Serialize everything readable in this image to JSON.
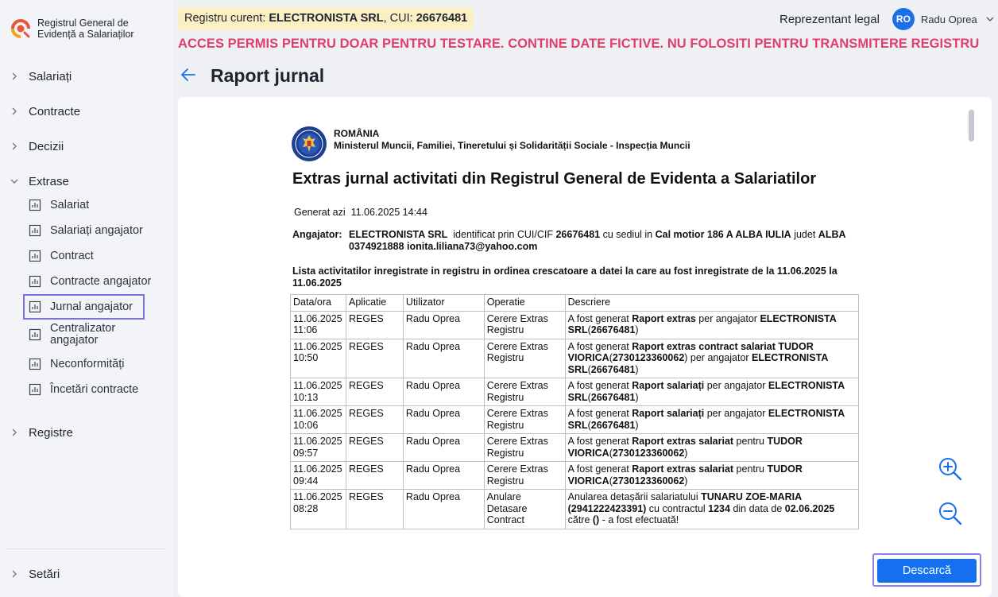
{
  "app": {
    "logo_text": "Registrul General de Evidență a Salariaților"
  },
  "header": {
    "registry_prefix": "Registru curent: ",
    "registry_company": "ELECTRONISTA SRL",
    "registry_cui_label": ", CUI: ",
    "registry_cui": "26676481",
    "role": "Reprezentant legal",
    "avatar_initials": "RO",
    "user_name": "Radu Oprea",
    "warning": "ACCES PERMIS PENTRU DOAR PENTRU TESTARE. CONTINE DATE FICTIVE. NU FOLOSITI PENTRU TRANSMITERE REGISTRU"
  },
  "page": {
    "title": "Raport jurnal"
  },
  "sidebar": {
    "sections": [
      {
        "label": "Salariați"
      },
      {
        "label": "Contracte"
      },
      {
        "label": "Decizii"
      },
      {
        "label": "Extrase"
      }
    ],
    "extrase_items": [
      {
        "label": "Salariat"
      },
      {
        "label": "Salariați angajator"
      },
      {
        "label": "Contract"
      },
      {
        "label": "Contracte angajator"
      },
      {
        "label": "Jurnal angajator",
        "active": true
      },
      {
        "label": "Centralizator angajator"
      },
      {
        "label": "Neconformități"
      },
      {
        "label": "Încetări contracte"
      }
    ],
    "registre": "Registre",
    "settings": "Setări"
  },
  "document": {
    "country": "ROMÂNIA",
    "ministry": "Ministerul Muncii, Familiei, Tineretului și Solidarității Sociale - Inspecția Muncii",
    "title": "Extras jurnal activitati din Registrul General de Evidenta a Salariatilor",
    "generated_label": "Generat azi",
    "generated_value": "11.06.2025 14:44",
    "employer_label": "Angajator:",
    "employer_name": "ELECTRONISTA SRL",
    "employer_id_text": "identificat prin CUI/CIF",
    "employer_cui": "26676481",
    "employer_seat_text": "cu sediul in",
    "employer_address": "Cal motior 186 A ALBA IULIA",
    "employer_county_text": "judet",
    "employer_county": "ALBA",
    "employer_phone": "0374921888",
    "employer_email": "ionita.liliana73@yahoo.com",
    "list_title": "Lista activitatilor inregistrate in registru in ordinea crescatoare a datei la care au fost inregistrate de la 11.06.2025 la 11.06.2025",
    "columns": [
      "Data/ora",
      "Aplicatie",
      "Utilizator",
      "Operatie",
      "Descriere"
    ],
    "rows": [
      {
        "date": "11.06.2025",
        "time": "11:06",
        "app": "REGES",
        "user": "Radu Oprea",
        "op": "Cerere Extras Registru",
        "desc": [
          {
            "t": "A fost generat "
          },
          {
            "b": "Raport extras"
          },
          {
            "t": " per angajator "
          },
          {
            "b": "ELECTRONISTA SRL"
          },
          {
            "t": "("
          },
          {
            "b": "26676481"
          },
          {
            "t": ")"
          }
        ]
      },
      {
        "date": "11.06.2025",
        "time": "10:50",
        "app": "REGES",
        "user": "Radu Oprea",
        "op": "Cerere Extras Registru",
        "desc": [
          {
            "t": "A fost generat "
          },
          {
            "b": "Raport extras contract salariat TUDOR VIORICA"
          },
          {
            "t": "("
          },
          {
            "b": "2730123360062"
          },
          {
            "t": ") per angajator "
          },
          {
            "b": "ELECTRONISTA SRL"
          },
          {
            "t": "("
          },
          {
            "b": "26676481"
          },
          {
            "t": ")"
          }
        ]
      },
      {
        "date": "11.06.2025",
        "time": "10:13",
        "app": "REGES",
        "user": "Radu Oprea",
        "op": "Cerere Extras Registru",
        "desc": [
          {
            "t": "A fost generat "
          },
          {
            "b": "Raport salariați"
          },
          {
            "t": " per angajator "
          },
          {
            "b": "ELECTRONISTA SRL"
          },
          {
            "t": "("
          },
          {
            "b": "26676481"
          },
          {
            "t": ")"
          }
        ]
      },
      {
        "date": "11.06.2025",
        "time": "10:06",
        "app": "REGES",
        "user": "Radu Oprea",
        "op": "Cerere Extras Registru",
        "desc": [
          {
            "t": "A fost generat "
          },
          {
            "b": "Raport salariați"
          },
          {
            "t": " per angajator "
          },
          {
            "b": "ELECTRONISTA SRL"
          },
          {
            "t": "("
          },
          {
            "b": "26676481"
          },
          {
            "t": ")"
          }
        ]
      },
      {
        "date": "11.06.2025",
        "time": "09:57",
        "app": "REGES",
        "user": "Radu Oprea",
        "op": "Cerere Extras Registru",
        "desc": [
          {
            "t": "A fost generat "
          },
          {
            "b": "Raport extras salariat"
          },
          {
            "t": " pentru "
          },
          {
            "b": "TUDOR VIORICA"
          },
          {
            "t": "("
          },
          {
            "b": "2730123360062"
          },
          {
            "t": ")"
          }
        ]
      },
      {
        "date": "11.06.2025",
        "time": "09:44",
        "app": "REGES",
        "user": "Radu Oprea",
        "op": "Cerere Extras Registru",
        "desc": [
          {
            "t": "A fost generat "
          },
          {
            "b": "Raport extras salariat"
          },
          {
            "t": " pentru "
          },
          {
            "b": "TUDOR VIORICA"
          },
          {
            "t": "("
          },
          {
            "b": "2730123360062"
          },
          {
            "t": ")"
          }
        ]
      },
      {
        "date": "11.06.2025",
        "time": "08:28",
        "app": "REGES",
        "user": "Radu Oprea",
        "op": "Anulare Detasare Contract",
        "desc": [
          {
            "t": "Anularea detașării salariatului "
          },
          {
            "b": "TUNARU ZOE-MARIA (2941222423391)"
          },
          {
            "t": " cu contractul "
          },
          {
            "b": "1234"
          },
          {
            "t": " din data de "
          },
          {
            "b": "02.06.2025"
          },
          {
            "t": " către "
          },
          {
            "b": "()"
          },
          {
            "t": " - a fost efectuată!"
          }
        ]
      }
    ]
  },
  "actions": {
    "download": "Descarcă"
  },
  "colors": {
    "accent": "#1570ef",
    "warning": "#e03e6b",
    "badge_bg": "#fbefc4",
    "focus_outline": "#7c6fe0"
  }
}
